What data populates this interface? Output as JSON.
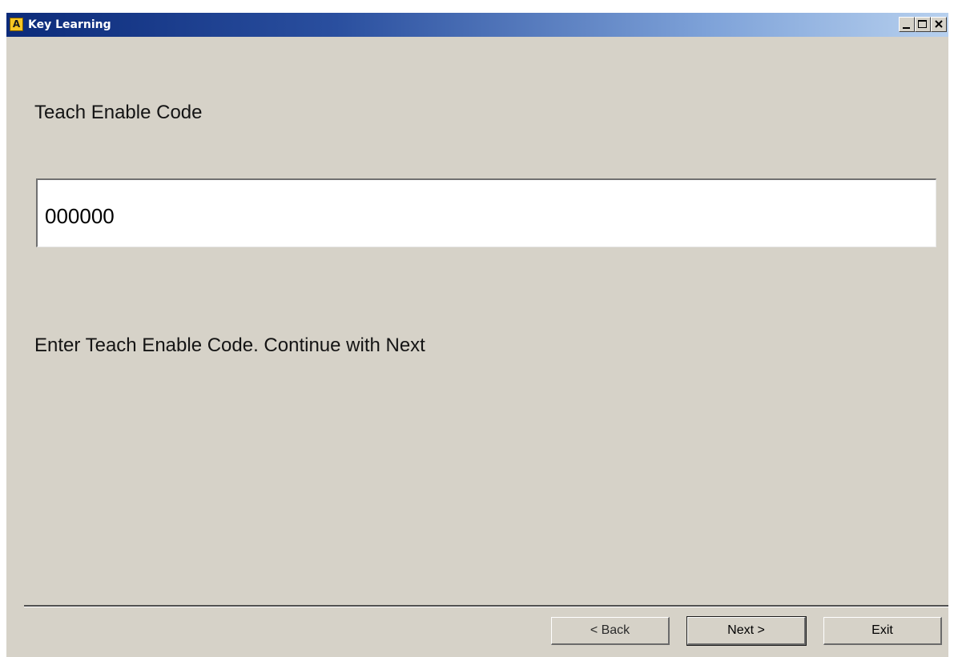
{
  "window": {
    "app_icon_letter": "A",
    "title": "Key Learning",
    "controls": {
      "minimize": "minimize-icon",
      "maximize": "maximize-icon",
      "close": "close-icon"
    }
  },
  "content": {
    "heading": "Teach Enable Code",
    "code_value": "000000",
    "instruction": "Enter Teach Enable Code. Continue with Next"
  },
  "buttons": {
    "back_label": "< Back",
    "next_label": "Next >",
    "exit_label": "Exit"
  },
  "colors": {
    "window_bg": "#d6d2c8",
    "titlebar_start": "#0c2b7a",
    "titlebar_end": "#b7d0ee"
  }
}
